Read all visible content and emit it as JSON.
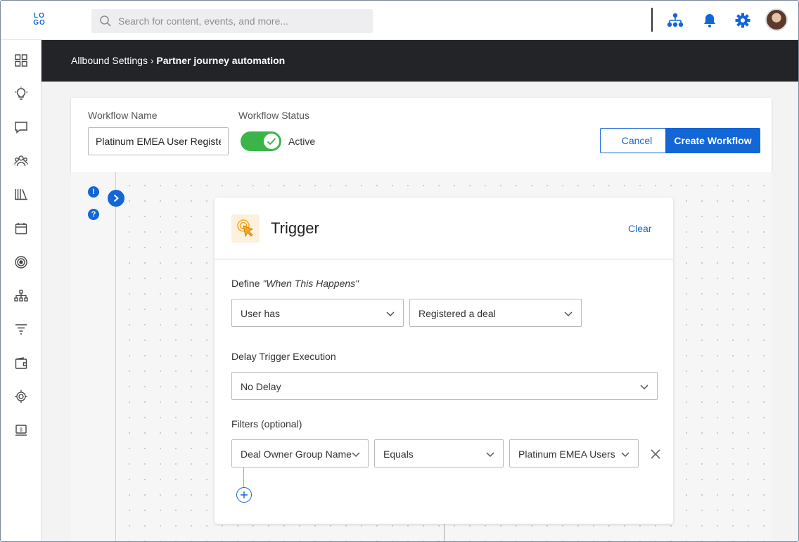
{
  "app": {
    "logo_text": "LOGO"
  },
  "search": {
    "placeholder": "Search for content, events, and more..."
  },
  "top_icons": [
    "org-chart-icon",
    "bell-icon",
    "gear-icon"
  ],
  "sidebar": {
    "items": [
      {
        "icon": "dashboard-icon"
      },
      {
        "icon": "lightbulb-icon"
      },
      {
        "icon": "chat-icon"
      },
      {
        "icon": "users-icon"
      },
      {
        "icon": "library-icon"
      },
      {
        "icon": "calendar-icon"
      },
      {
        "icon": "target-icon"
      },
      {
        "icon": "hierarchy-icon"
      },
      {
        "icon": "filter-icon"
      },
      {
        "icon": "wallet-icon"
      },
      {
        "icon": "integration-icon"
      },
      {
        "icon": "billing-icon"
      }
    ]
  },
  "breadcrumb": {
    "parent": "Allbound Settings",
    "separator": "›",
    "current": "Partner journey automation"
  },
  "workflow": {
    "name_label": "Workflow Name",
    "name_value": "Platinum EMEA User Registered Deal",
    "status_label": "Workflow Status",
    "status_value": "Active",
    "cancel_label": "Cancel",
    "create_label": "Create Workflow"
  },
  "trigger": {
    "title": "Trigger",
    "clear_label": "Clear",
    "define_label": "Define",
    "define_quote": "\"When This Happens\"",
    "subject_select": "User has",
    "event_select": "Registered a deal",
    "delay_label": "Delay Trigger Execution",
    "delay_select": "No Delay",
    "filters_label": "Filters (optional)",
    "filter": {
      "field": "Deal Owner Group Name",
      "operator": "Equals",
      "value": "Platinum EMEA Users"
    }
  },
  "colors": {
    "accent": "#1366d6",
    "active_toggle": "#3bb54a",
    "header_bar": "#222427"
  }
}
